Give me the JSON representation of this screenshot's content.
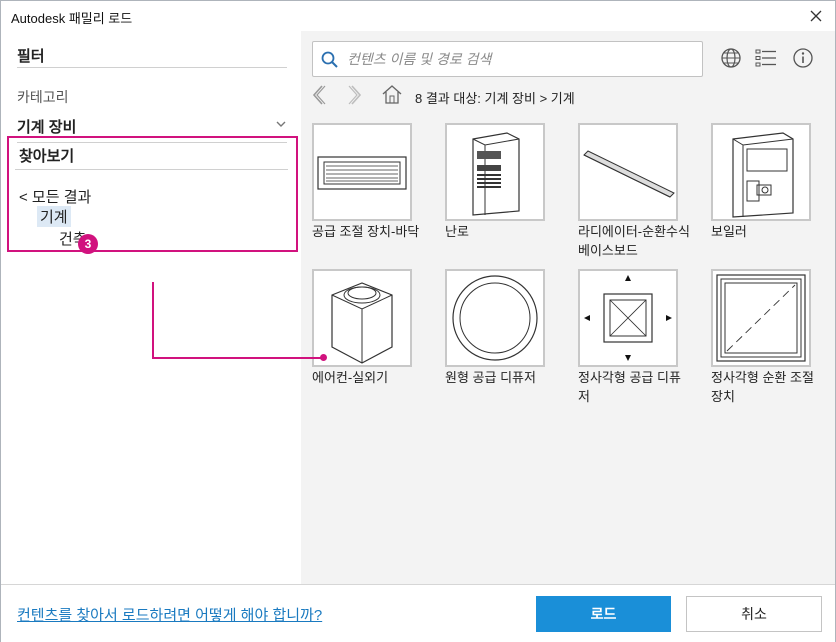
{
  "window": {
    "title": "Autodesk 패밀리 로드"
  },
  "filter": {
    "heading": "필터",
    "category_label": "카테고리",
    "category_value": "기계 장비"
  },
  "browse": {
    "heading": "찾아보기",
    "all_results": "< 모든 결과",
    "mechanical": "기계",
    "architecture": "건축",
    "callout_number": "3",
    "highlight_color": "#d1127e"
  },
  "search": {
    "placeholder": "컨텐츠 이름 및 경로 검색"
  },
  "breadcrumb": {
    "text": "8 결과 대상: 기계 장비 > 기계"
  },
  "tiles": [
    {
      "label": "공급 조절 장치-바닥",
      "icon": "floor-register-grille"
    },
    {
      "label": "난로",
      "icon": "furnace-cabinet"
    },
    {
      "label": "라디에이터-순환수식 베이스보드",
      "icon": "baseboard-radiator"
    },
    {
      "label": "보일러",
      "icon": "boiler"
    },
    {
      "label": "에어컨-실외기",
      "icon": "outdoor-condenser"
    },
    {
      "label": "원형 공급 디퓨저",
      "icon": "round-diffuser"
    },
    {
      "label": "정사각형 공급 디퓨저",
      "icon": "square-supply-diffuser"
    },
    {
      "label": "정사각형 순환 조절 장치",
      "icon": "square-return-register"
    }
  ],
  "footer": {
    "help_link": "컨텐츠를 찾아서 로드하려면 어떻게 해야 합니까?",
    "load_button": "로드",
    "cancel_button": "취소",
    "accent_color": "#1a8fd8"
  }
}
